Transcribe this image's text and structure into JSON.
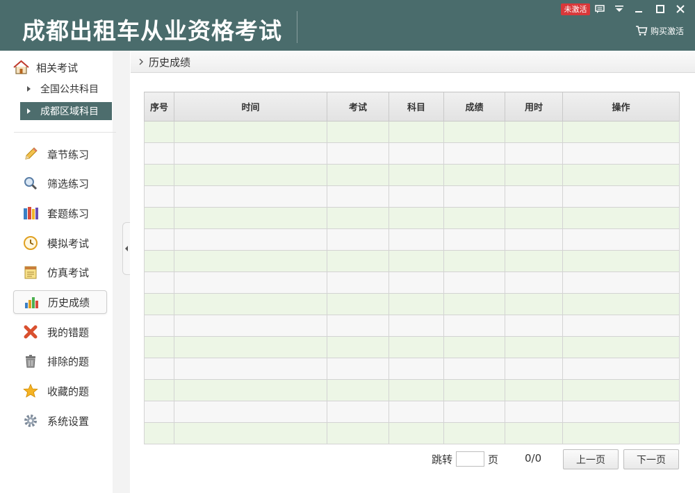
{
  "app": {
    "title": "成都出租车从业资格考试"
  },
  "titlebar": {
    "badge": "未激活",
    "buy_label": "购买激活"
  },
  "sidebar": {
    "related_label": "相关考试",
    "sub_items": [
      {
        "label": "全国公共科目",
        "active": false
      },
      {
        "label": "成都区域科目",
        "active": true
      }
    ],
    "nav": [
      {
        "label": "章节练习",
        "icon": "pencil-icon"
      },
      {
        "label": "筛选练习",
        "icon": "magnifier-icon"
      },
      {
        "label": "套题练习",
        "icon": "books-icon"
      },
      {
        "label": "模拟考试",
        "icon": "clock-icon"
      },
      {
        "label": "仿真考试",
        "icon": "notepad-icon"
      },
      {
        "label": "历史成绩",
        "icon": "bar-chart-icon",
        "active": true
      },
      {
        "label": "我的错题",
        "icon": "red-x-icon"
      },
      {
        "label": "排除的题",
        "icon": "trash-icon"
      },
      {
        "label": "收藏的题",
        "icon": "star-icon"
      },
      {
        "label": "系统设置",
        "icon": "gear-icon"
      }
    ]
  },
  "main": {
    "breadcrumb": "历史成绩",
    "table": {
      "columns": [
        "序号",
        "时间",
        "考试",
        "科目",
        "成绩",
        "用时",
        "操作"
      ],
      "rows": []
    },
    "pager": {
      "jump_label": "跳转",
      "page_label": "页",
      "page_value": "",
      "count": "0/0",
      "prev_label": "上一页",
      "next_label": "下一页"
    }
  },
  "colors": {
    "titlebar": "#4a6c6c",
    "active_item": "#4d6d6d",
    "row_green": "#edf6e6",
    "row_gray": "#f7f7f7",
    "badge": "#d9383a"
  }
}
